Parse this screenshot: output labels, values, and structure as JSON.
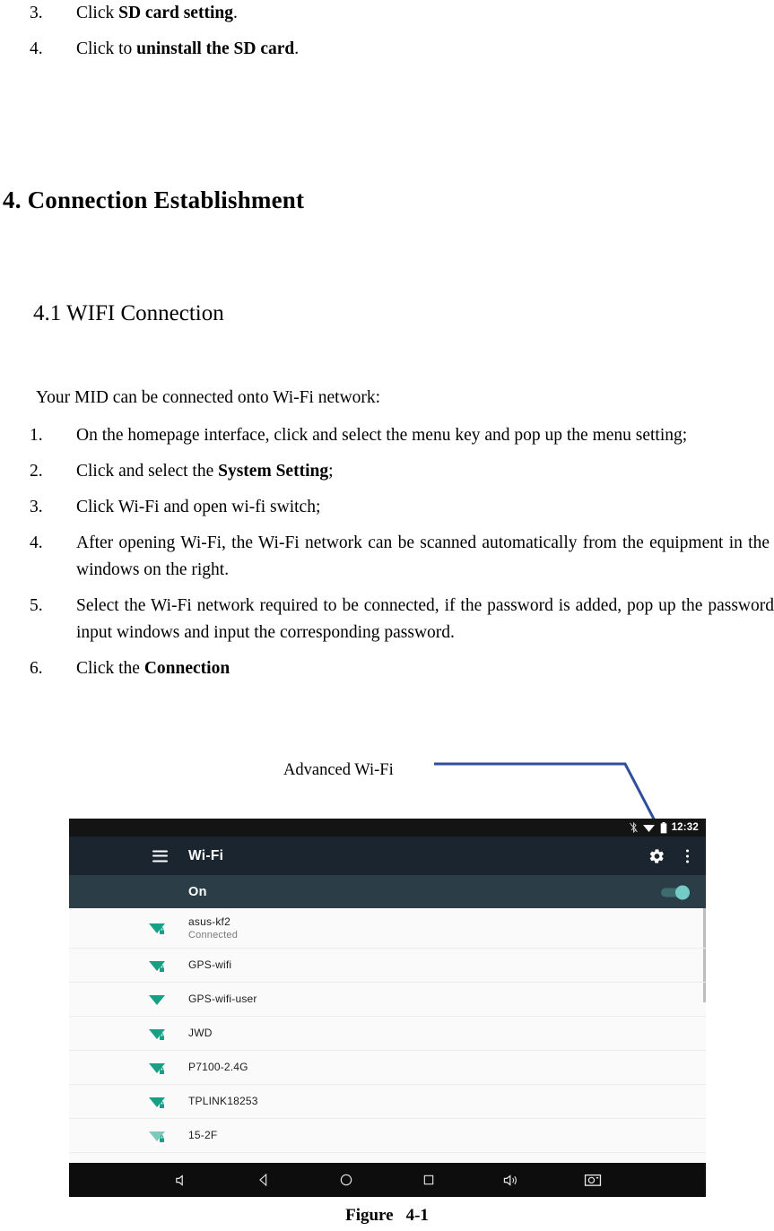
{
  "document": {
    "top_steps": [
      {
        "num": "3.",
        "prefix": "Click ",
        "bold": "SD card setting",
        "suffix": "."
      },
      {
        "num": "4.",
        "prefix": "Click to ",
        "bold": "uninstall the SD card",
        "suffix": "."
      }
    ],
    "heading1": "4. Connection Establishment",
    "heading2": "4.1 WIFI Connection",
    "intro": "Your MID can be connected onto Wi-Fi network:",
    "steps": [
      {
        "num": "1.",
        "prefix": "On the homepage interface, click and select the menu key and pop up the menu setting;",
        "bold": "",
        "suffix": ""
      },
      {
        "num": "2.",
        "prefix": "Click and select the ",
        "bold": "System Setting",
        "suffix": ";"
      },
      {
        "num": "3.",
        "prefix": "Click Wi-Fi and open wi-fi switch;",
        "bold": "",
        "suffix": ""
      },
      {
        "num": "4.",
        "prefix": "After opening Wi-Fi, the Wi-Fi network can be scanned automatically from the equipment in the windows on the right.",
        "bold": "",
        "suffix": ""
      },
      {
        "num": "5.",
        "prefix": "Select the Wi-Fi network required to be connected, if the password is added, pop up the password input windows and input the corresponding password.",
        "bold": "",
        "suffix": ""
      },
      {
        "num": "6.",
        "prefix": "Click the ",
        "bold": "Connection",
        "suffix": ""
      }
    ],
    "annotation": "Advanced Wi-Fi",
    "annotation_line_color": "#2f4f9b",
    "caption_label": "Figure",
    "caption_number": "4-1"
  },
  "tablet": {
    "statusbar": {
      "bluetooth_icon": "bluetooth-icon",
      "wifi_icon": "wifi-signal-icon",
      "battery_icon": "battery-full-icon",
      "time": "12:32"
    },
    "actionbar": {
      "menu_icon": "hamburger-menu-icon",
      "title": "Wi-Fi",
      "settings_icon": "gear-icon",
      "overflow_icon": "overflow-menu-icon"
    },
    "toggle_row": {
      "label": "On",
      "switch_state": "on",
      "track_color": "#3e6b6e",
      "thumb_color": "#73ccc6"
    },
    "networks": [
      {
        "ssid": "asus-kf2",
        "status": "Connected",
        "secured": true,
        "bars": 4,
        "dim": false
      },
      {
        "ssid": "GPS-wifi",
        "status": "",
        "secured": true,
        "bars": 4,
        "dim": false
      },
      {
        "ssid": "GPS-wifi-user",
        "status": "",
        "secured": false,
        "bars": 4,
        "dim": false
      },
      {
        "ssid": "JWD",
        "status": "",
        "secured": true,
        "bars": 4,
        "dim": false
      },
      {
        "ssid": "P7100-2.4G",
        "status": "",
        "secured": true,
        "bars": 4,
        "dim": false
      },
      {
        "ssid": "TPLINK18253",
        "status": "",
        "secured": true,
        "bars": 4,
        "dim": false
      },
      {
        "ssid": "15-2F",
        "status": "",
        "secured": true,
        "bars": 3,
        "dim": true
      }
    ],
    "navbar": [
      {
        "name": "volume-down-icon"
      },
      {
        "name": "back-icon"
      },
      {
        "name": "home-icon"
      },
      {
        "name": "recents-icon"
      },
      {
        "name": "volume-up-icon"
      },
      {
        "name": "screenshot-icon"
      }
    ],
    "colors": {
      "statusbar_bg": "#141414",
      "actionbar_bg": "#1b2530",
      "toggle_bar_bg": "#2b3d47",
      "list_bg": "#fafafa",
      "navbar_bg": "#0d0d0d",
      "wifi_icon_color": "#16a085"
    }
  }
}
